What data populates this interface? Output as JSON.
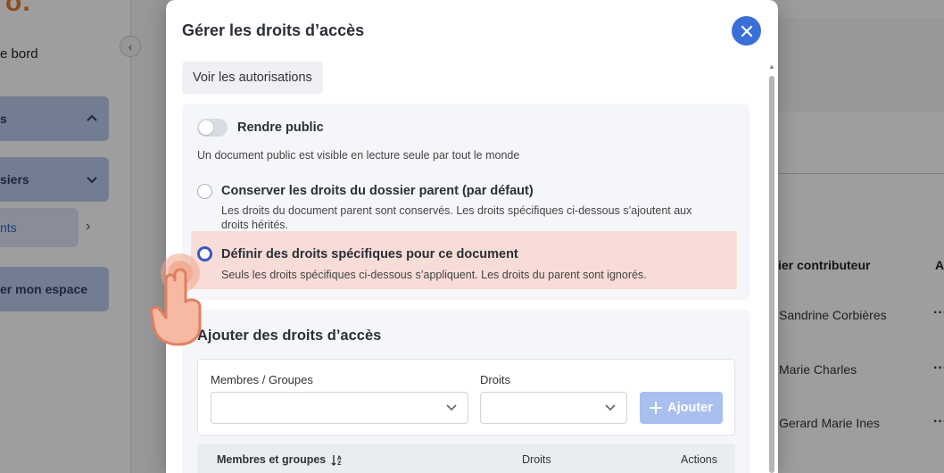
{
  "background": {
    "logo_text": "o.",
    "nav_text": "e bord",
    "nav_items": [
      {
        "label": "s",
        "chevron": "chevron-up"
      },
      {
        "label": "siers",
        "chevron": "chevron-down"
      }
    ],
    "nav_sub_item": "nts",
    "nav_space_button": "er mon espace",
    "column_headers": [
      "ier contributeur",
      "A"
    ],
    "contributors": [
      "Sandrine Corbières",
      "Marie Charles",
      "Gerard Marie Ines"
    ],
    "row_actions": "···"
  },
  "modal": {
    "title": "Gérer les droits d’accès",
    "close_icon": "close-icon",
    "tab_label": "Voir les autorisations",
    "public": {
      "label": "Rendre public",
      "enabled": false,
      "description": "Un document public est visible en lecture seule par tout le monde"
    },
    "options": [
      {
        "title": "Conserver les droits du dossier parent (par défaut)",
        "description_line1": "Les droits du document parent sont conservés. Les droits spécifiques ci-dessous s’ajoutent aux",
        "description_line2": "droits hérités.",
        "selected": false
      },
      {
        "title": "Définir des droits spécifiques pour ce document",
        "description_line1": "Seuls les droits spécifiques ci-dessous s’appliquent. Les droits du parent sont ignorés.",
        "selected": true
      }
    ],
    "add_section": {
      "title": "Ajouter des droits d’accès",
      "members_label": "Membres / Groupes",
      "members_value": "",
      "rights_label": "Droits",
      "rights_value": "",
      "add_button": "Ajouter",
      "table_headers": {
        "members": "Membres et groupes",
        "rights": "Droits",
        "actions": "Actions"
      }
    }
  },
  "colors": {
    "primary": "#3b6fd8",
    "highlight": "#f7dcd8",
    "add_button": "#a9bfee",
    "hand": "#f2a48a"
  }
}
